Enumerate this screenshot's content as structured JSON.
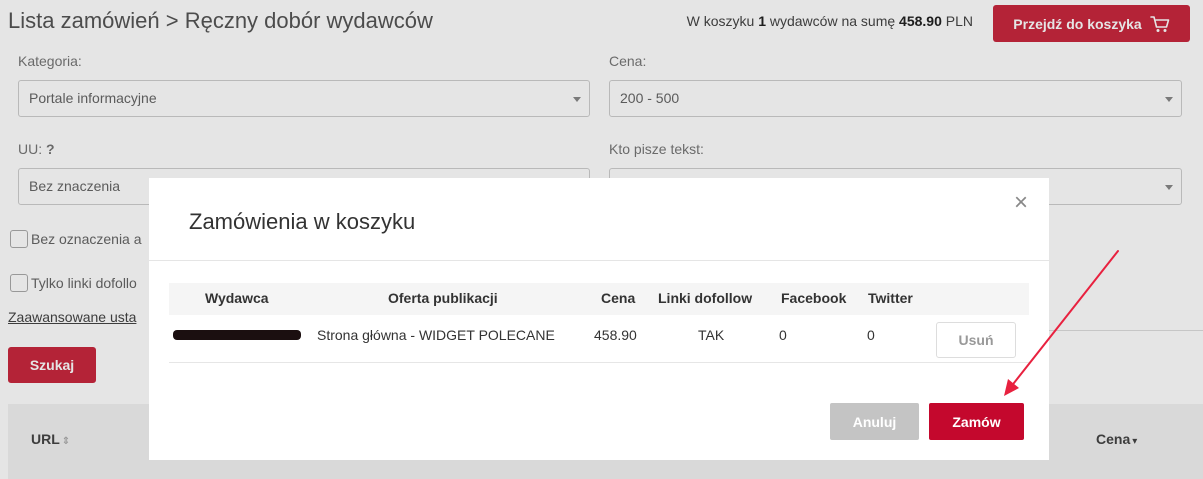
{
  "header": {
    "breadcrumb": "Lista zamówień > Ręczny dobór wydawców",
    "cart_prefix": "W koszyku ",
    "cart_count": "1",
    "cart_middle": " wydawców na sumę ",
    "cart_total": "458.90",
    "cart_currency": " PLN",
    "cart_button": "Przejdź do koszyka"
  },
  "filters": {
    "category_label": "Kategoria:",
    "category_value": "Portale informacyjne",
    "price_label": "Cena:",
    "price_value": "200 - 500",
    "uu_label": "UU:",
    "uu_help": "?",
    "uu_value": "Bez znaczenia",
    "writer_label": "Kto pisze tekst:",
    "writer_value": "",
    "checkbox_1": "Bez oznaczenia a",
    "checkbox_2": "Tylko linki dofollo",
    "advanced_link": "Zaawansowane usta",
    "search_button": "Szukaj"
  },
  "results": {
    "col_url": "URL",
    "col_price": "Cena"
  },
  "modal": {
    "title": "Zamówienia w koszyku",
    "close": "×",
    "columns": [
      "Wydawca",
      "Oferta publikacji",
      "Cena",
      "Linki dofollow",
      "Facebook",
      "Twitter"
    ],
    "rows": [
      {
        "offer": "Strona główna - WIDGET POLECANE",
        "price": "458.90",
        "dofollow": "TAK",
        "facebook": "0",
        "twitter": "0",
        "remove_label": "Usuń"
      }
    ],
    "cancel_button": "Anuluj",
    "order_button": "Zamów"
  },
  "colors": {
    "accent": "#c9283e",
    "order": "#c4082d",
    "arrow": "#e8213f"
  }
}
